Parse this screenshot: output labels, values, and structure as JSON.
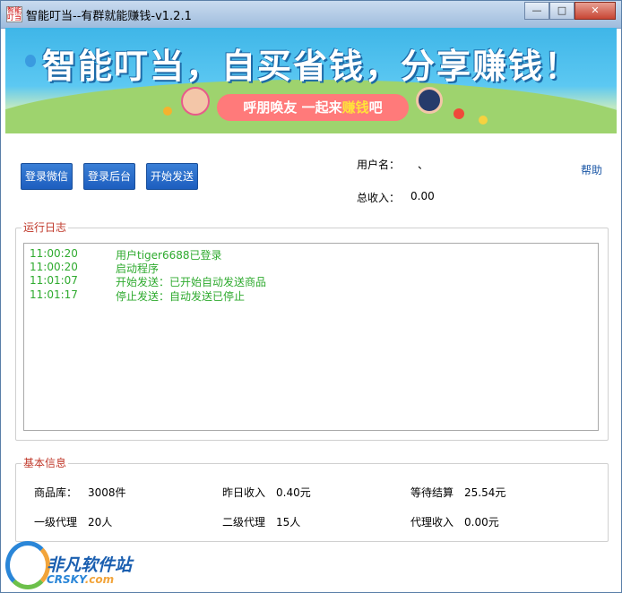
{
  "window": {
    "title": "智能叮当--有群就能赚钱-v1.2.1",
    "icon_text": "智能叮当",
    "controls": [
      "—",
      "□",
      "✕"
    ]
  },
  "banner": {
    "headline": "智能叮当，自买省钱，分享赚钱！",
    "tagline_a": "呼朋唤友  一起来",
    "tagline_b": "赚钱",
    "tagline_c": "吧"
  },
  "toolbar": {
    "login_wechat": "登录微信",
    "login_admin": "登录后台",
    "start_send": "开始发送"
  },
  "user": {
    "username_label": "用户名：",
    "username_value": "、",
    "income_label": "总收入：",
    "income_value": "0.00",
    "help_link": "帮助"
  },
  "log": {
    "title": "运行日志",
    "entries": [
      {
        "time": "11:00:20",
        "msg": "用户tiger6688已登录"
      },
      {
        "time": "11:00:20",
        "msg": "启动程序"
      },
      {
        "time": "11:01:07",
        "msg": "开始发送：已开始自动发送商品"
      },
      {
        "time": "11:01:17",
        "msg": "停止发送：自动发送已停止"
      }
    ]
  },
  "info": {
    "title": "基本信息",
    "items": [
      {
        "label": "商品库：",
        "value": "3008件"
      },
      {
        "label": "昨日收入",
        "value": "0.40元"
      },
      {
        "label": "等待结算",
        "value": "25.54元"
      },
      {
        "label": "一级代理",
        "value": "20人"
      },
      {
        "label": "二级代理",
        "value": "15人"
      },
      {
        "label": "代理收入",
        "value": "0.00元"
      }
    ]
  },
  "watermark": {
    "cn": "非凡软件站",
    "en": "CRSKY",
    "domain": ".com"
  }
}
